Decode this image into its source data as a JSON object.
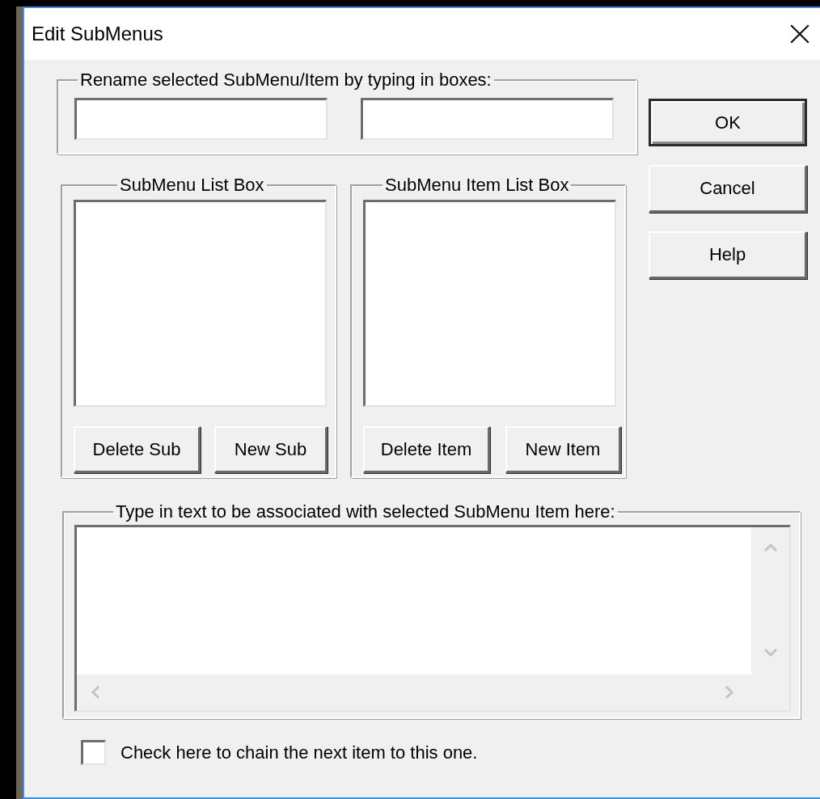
{
  "window": {
    "title": "Edit SubMenus"
  },
  "rename_group": {
    "label": "Rename selected SubMenu/Item by typing in boxes:"
  },
  "dialog_buttons": [
    {
      "label": "OK",
      "default": true
    },
    {
      "label": "Cancel",
      "default": false
    },
    {
      "label": "Help",
      "default": false
    }
  ],
  "list_groups": [
    {
      "label": "SubMenu List Box",
      "buttons": [
        "Delete Sub",
        "New Sub"
      ]
    },
    {
      "label": "SubMenu Item List Box",
      "buttons": [
        "Delete Item",
        "New Item"
      ]
    }
  ],
  "text_group": {
    "label": "Type in text to be associated with selected SubMenu Item here:"
  },
  "chain_checkbox": {
    "label": "Check here to chain the next item to this one.",
    "checked": false
  }
}
